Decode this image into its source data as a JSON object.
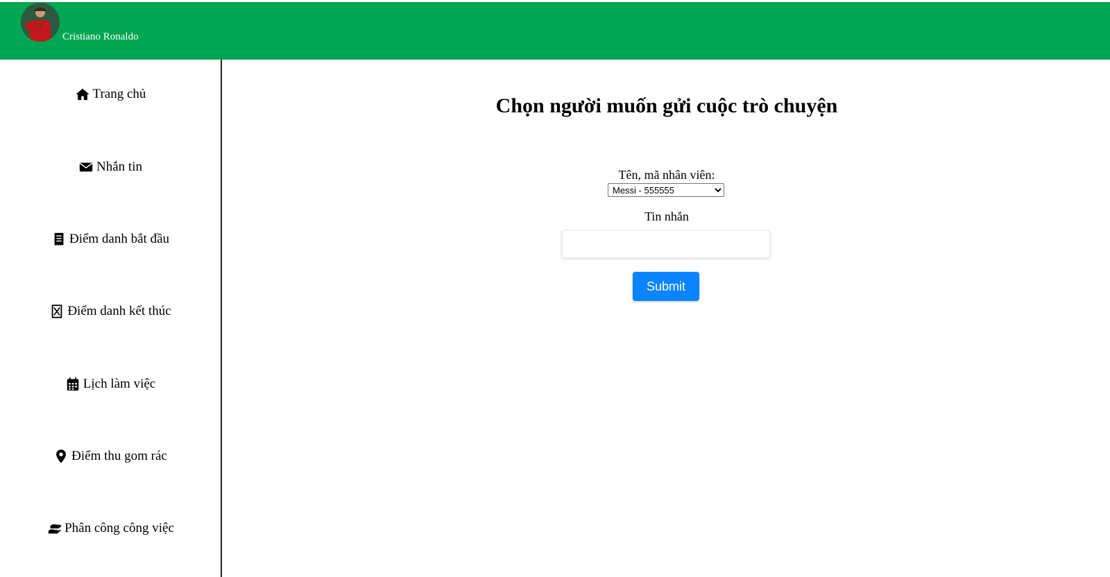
{
  "header": {
    "user_name": "Cristiano Ronaldo",
    "background_color": "#00a651"
  },
  "sidebar": {
    "items": [
      {
        "label": "Trang chủ",
        "icon": "home-icon"
      },
      {
        "label": "Nhắn tin",
        "icon": "envelope-icon"
      },
      {
        "label": "Điểm danh bắt đầu",
        "icon": "receipt-icon"
      },
      {
        "label": "Điểm danh kết thúc",
        "icon": "rectangle-xmark-icon"
      },
      {
        "label": "Lịch làm việc",
        "icon": "calendar-icon"
      },
      {
        "label": "Điểm thu gom rác",
        "icon": "map-pin-icon"
      },
      {
        "label": "Phân công công việc",
        "icon": "hand-holding-icon"
      }
    ]
  },
  "main": {
    "title": "Chọn người muốn gửi cuộc trò chuyện",
    "employee_label": "Tên, mã nhân viên:",
    "employee_selected": "Messi - 555555",
    "message_label": "Tin nhắn",
    "message_value": "",
    "submit_label": "Submit",
    "submit_color": "#0a84ff"
  }
}
